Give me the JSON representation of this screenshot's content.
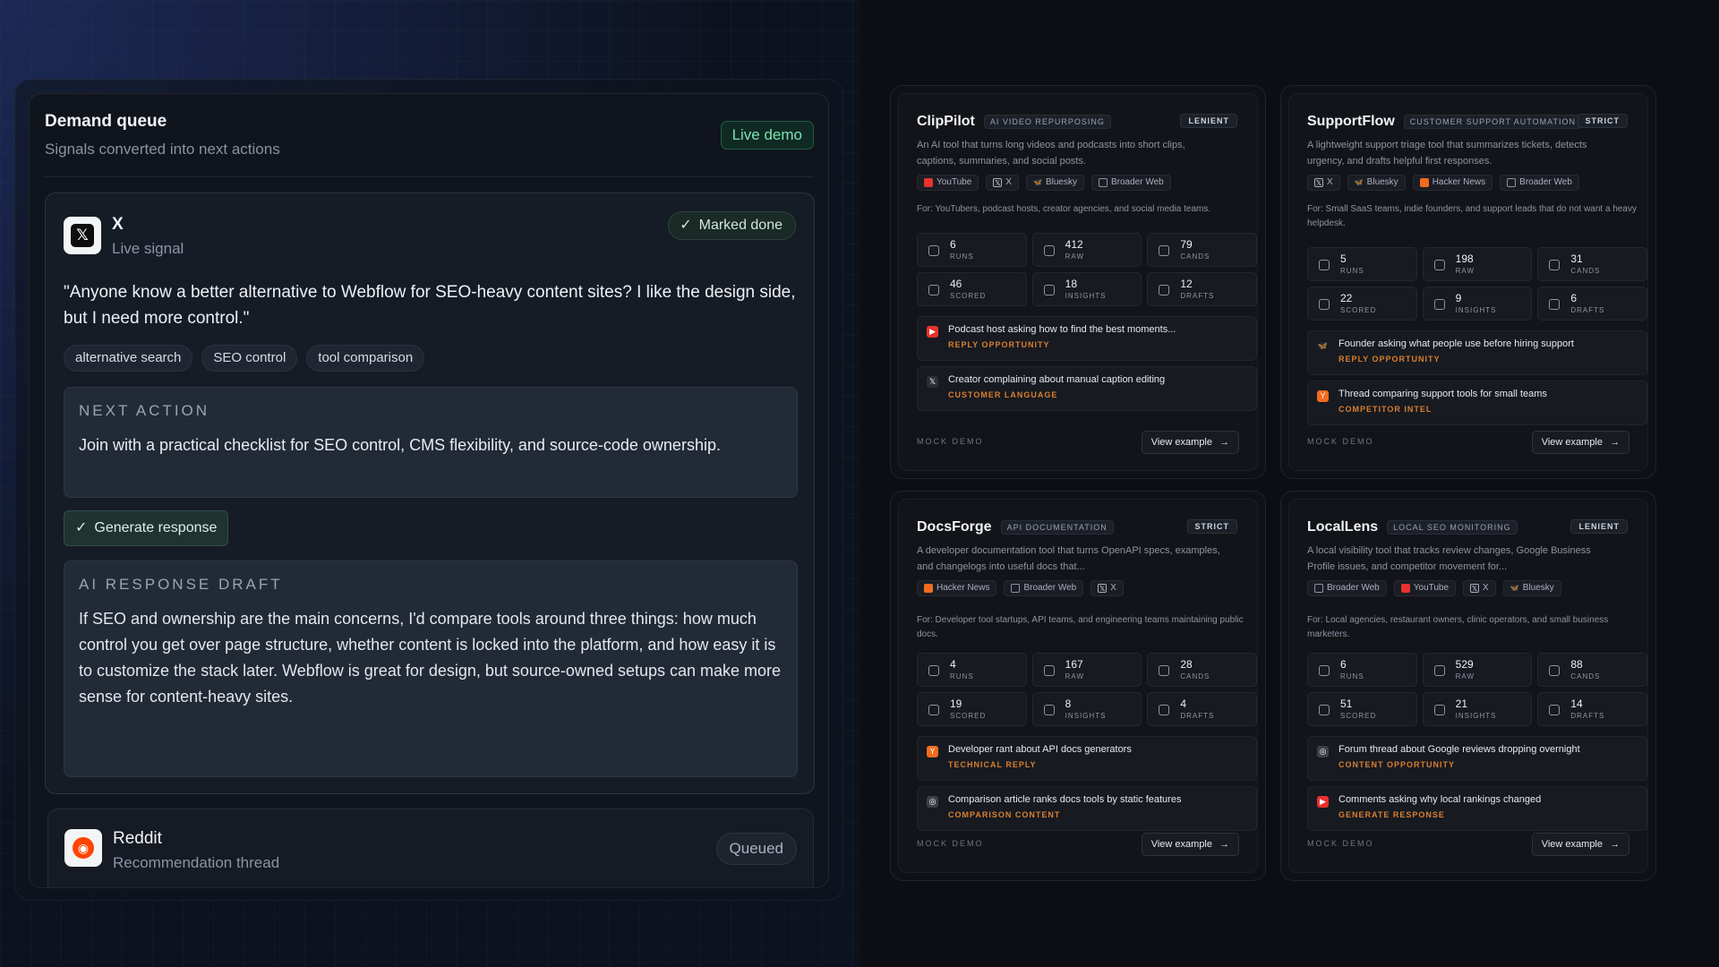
{
  "queue": {
    "title": "Demand queue",
    "subtitle": "Signals converted into next actions",
    "live_badge": "Live demo"
  },
  "active_signal": {
    "source": "X",
    "type": "Live signal",
    "status": "Marked done",
    "quote": "\"Anyone know a better alternative to Webflow for SEO-heavy content sites? I like the design side, but I need more control.\"",
    "tags": [
      "alternative search",
      "SEO control",
      "tool comparison"
    ],
    "next_action_label": "NEXT ACTION",
    "next_action_text": "Join with a practical checklist for SEO control, CMS flexibility, and source-code ownership.",
    "generate_button": "Generate response",
    "draft_label": "AI RESPONSE DRAFT",
    "draft_text": "If SEO and ownership are the main concerns, I'd compare tools around three things: how much control you get over page structure, whether content is locked into the platform, and how easy it is to customize the stack later. Webflow is great for design, but source-owned setups can make more sense for content-heavy sites."
  },
  "queued_signal": {
    "source": "Reddit",
    "type": "Recommendation thread",
    "status": "Queued"
  },
  "products": [
    {
      "name": "ClipPilot",
      "category": "AI VIDEO REPURPOSING",
      "mode": "LENIENT",
      "description": "An AI tool that turns long videos and podcasts into short clips, captions, summaries, and social posts.",
      "sources": [
        {
          "label": "YouTube",
          "icon": "youtube"
        },
        {
          "label": "X",
          "icon": "x"
        },
        {
          "label": "Bluesky",
          "icon": "bluesky"
        },
        {
          "label": "Broader Web",
          "icon": "web"
        }
      ],
      "for": "For: YouTubers, podcast hosts, creator agencies, and social media teams.",
      "stats": [
        {
          "v": "6",
          "l": "RUNS"
        },
        {
          "v": "412",
          "l": "RAW"
        },
        {
          "v": "79",
          "l": "CANDS"
        },
        {
          "v": "46",
          "l": "SCORED"
        },
        {
          "v": "18",
          "l": "INSIGHTS"
        },
        {
          "v": "12",
          "l": "DRAFTS"
        }
      ],
      "signals": [
        {
          "icon": "youtube",
          "text": "Podcast host asking how to find the best moments...",
          "label": "REPLY OPPORTUNITY"
        },
        {
          "icon": "x",
          "text": "Creator complaining about manual caption editing",
          "label": "CUSTOMER LANGUAGE"
        }
      ],
      "footer": "MOCK DEMO",
      "button": "View example"
    },
    {
      "name": "SupportFlow",
      "category": "CUSTOMER SUPPORT AUTOMATION",
      "mode": "STRICT",
      "description": "A lightweight support triage tool that summarizes tickets, detects urgency, and drafts helpful first responses.",
      "sources": [
        {
          "label": "X",
          "icon": "x"
        },
        {
          "label": "Bluesky",
          "icon": "bluesky"
        },
        {
          "label": "Hacker News",
          "icon": "hn"
        },
        {
          "label": "Broader Web",
          "icon": "web"
        }
      ],
      "for": "For: Small SaaS teams, indie founders, and support leads that do not want a heavy helpdesk.",
      "stats": [
        {
          "v": "5",
          "l": "RUNS"
        },
        {
          "v": "198",
          "l": "RAW"
        },
        {
          "v": "31",
          "l": "CANDS"
        },
        {
          "v": "22",
          "l": "SCORED"
        },
        {
          "v": "9",
          "l": "INSIGHTS"
        },
        {
          "v": "6",
          "l": "DRAFTS"
        }
      ],
      "signals": [
        {
          "icon": "bluesky",
          "text": "Founder asking what people use before hiring support",
          "label": "REPLY OPPORTUNITY"
        },
        {
          "icon": "hn",
          "text": "Thread comparing support tools for small teams",
          "label": "COMPETITOR INTEL"
        }
      ],
      "footer": "MOCK DEMO",
      "button": "View example"
    },
    {
      "name": "DocsForge",
      "category": "API DOCUMENTATION",
      "mode": "STRICT",
      "description": "A developer documentation tool that turns OpenAPI specs, examples, and changelogs into useful docs that...",
      "sources": [
        {
          "label": "Hacker News",
          "icon": "hn"
        },
        {
          "label": "Broader Web",
          "icon": "web"
        },
        {
          "label": "X",
          "icon": "x"
        }
      ],
      "for": "For: Developer tool startups, API teams, and engineering teams maintaining public docs.",
      "stats": [
        {
          "v": "4",
          "l": "RUNS"
        },
        {
          "v": "167",
          "l": "RAW"
        },
        {
          "v": "28",
          "l": "CANDS"
        },
        {
          "v": "19",
          "l": "SCORED"
        },
        {
          "v": "8",
          "l": "INSIGHTS"
        },
        {
          "v": "4",
          "l": "DRAFTS"
        }
      ],
      "signals": [
        {
          "icon": "hn",
          "text": "Developer rant about API docs generators",
          "label": "TECHNICAL REPLY"
        },
        {
          "icon": "web",
          "text": "Comparison article ranks docs tools by static features",
          "label": "COMPARISON CONTENT"
        }
      ],
      "footer": "MOCK DEMO",
      "button": "View example"
    },
    {
      "name": "LocalLens",
      "category": "LOCAL SEO MONITORING",
      "mode": "LENIENT",
      "description": "A local visibility tool that tracks review changes, Google Business Profile issues, and competitor movement for...",
      "sources": [
        {
          "label": "Broader Web",
          "icon": "web"
        },
        {
          "label": "YouTube",
          "icon": "youtube"
        },
        {
          "label": "X",
          "icon": "x"
        },
        {
          "label": "Bluesky",
          "icon": "bluesky"
        }
      ],
      "for": "For: Local agencies, restaurant owners, clinic operators, and small business marketers.",
      "stats": [
        {
          "v": "6",
          "l": "RUNS"
        },
        {
          "v": "529",
          "l": "RAW"
        },
        {
          "v": "88",
          "l": "CANDS"
        },
        {
          "v": "51",
          "l": "SCORED"
        },
        {
          "v": "21",
          "l": "INSIGHTS"
        },
        {
          "v": "14",
          "l": "DRAFTS"
        }
      ],
      "signals": [
        {
          "icon": "web",
          "text": "Forum thread about Google reviews dropping overnight",
          "label": "CONTENT OPPORTUNITY"
        },
        {
          "icon": "youtube",
          "text": "Comments asking why local rankings changed",
          "label": "GENERATE RESPONSE"
        }
      ],
      "footer": "MOCK DEMO",
      "button": "View example"
    }
  ]
}
